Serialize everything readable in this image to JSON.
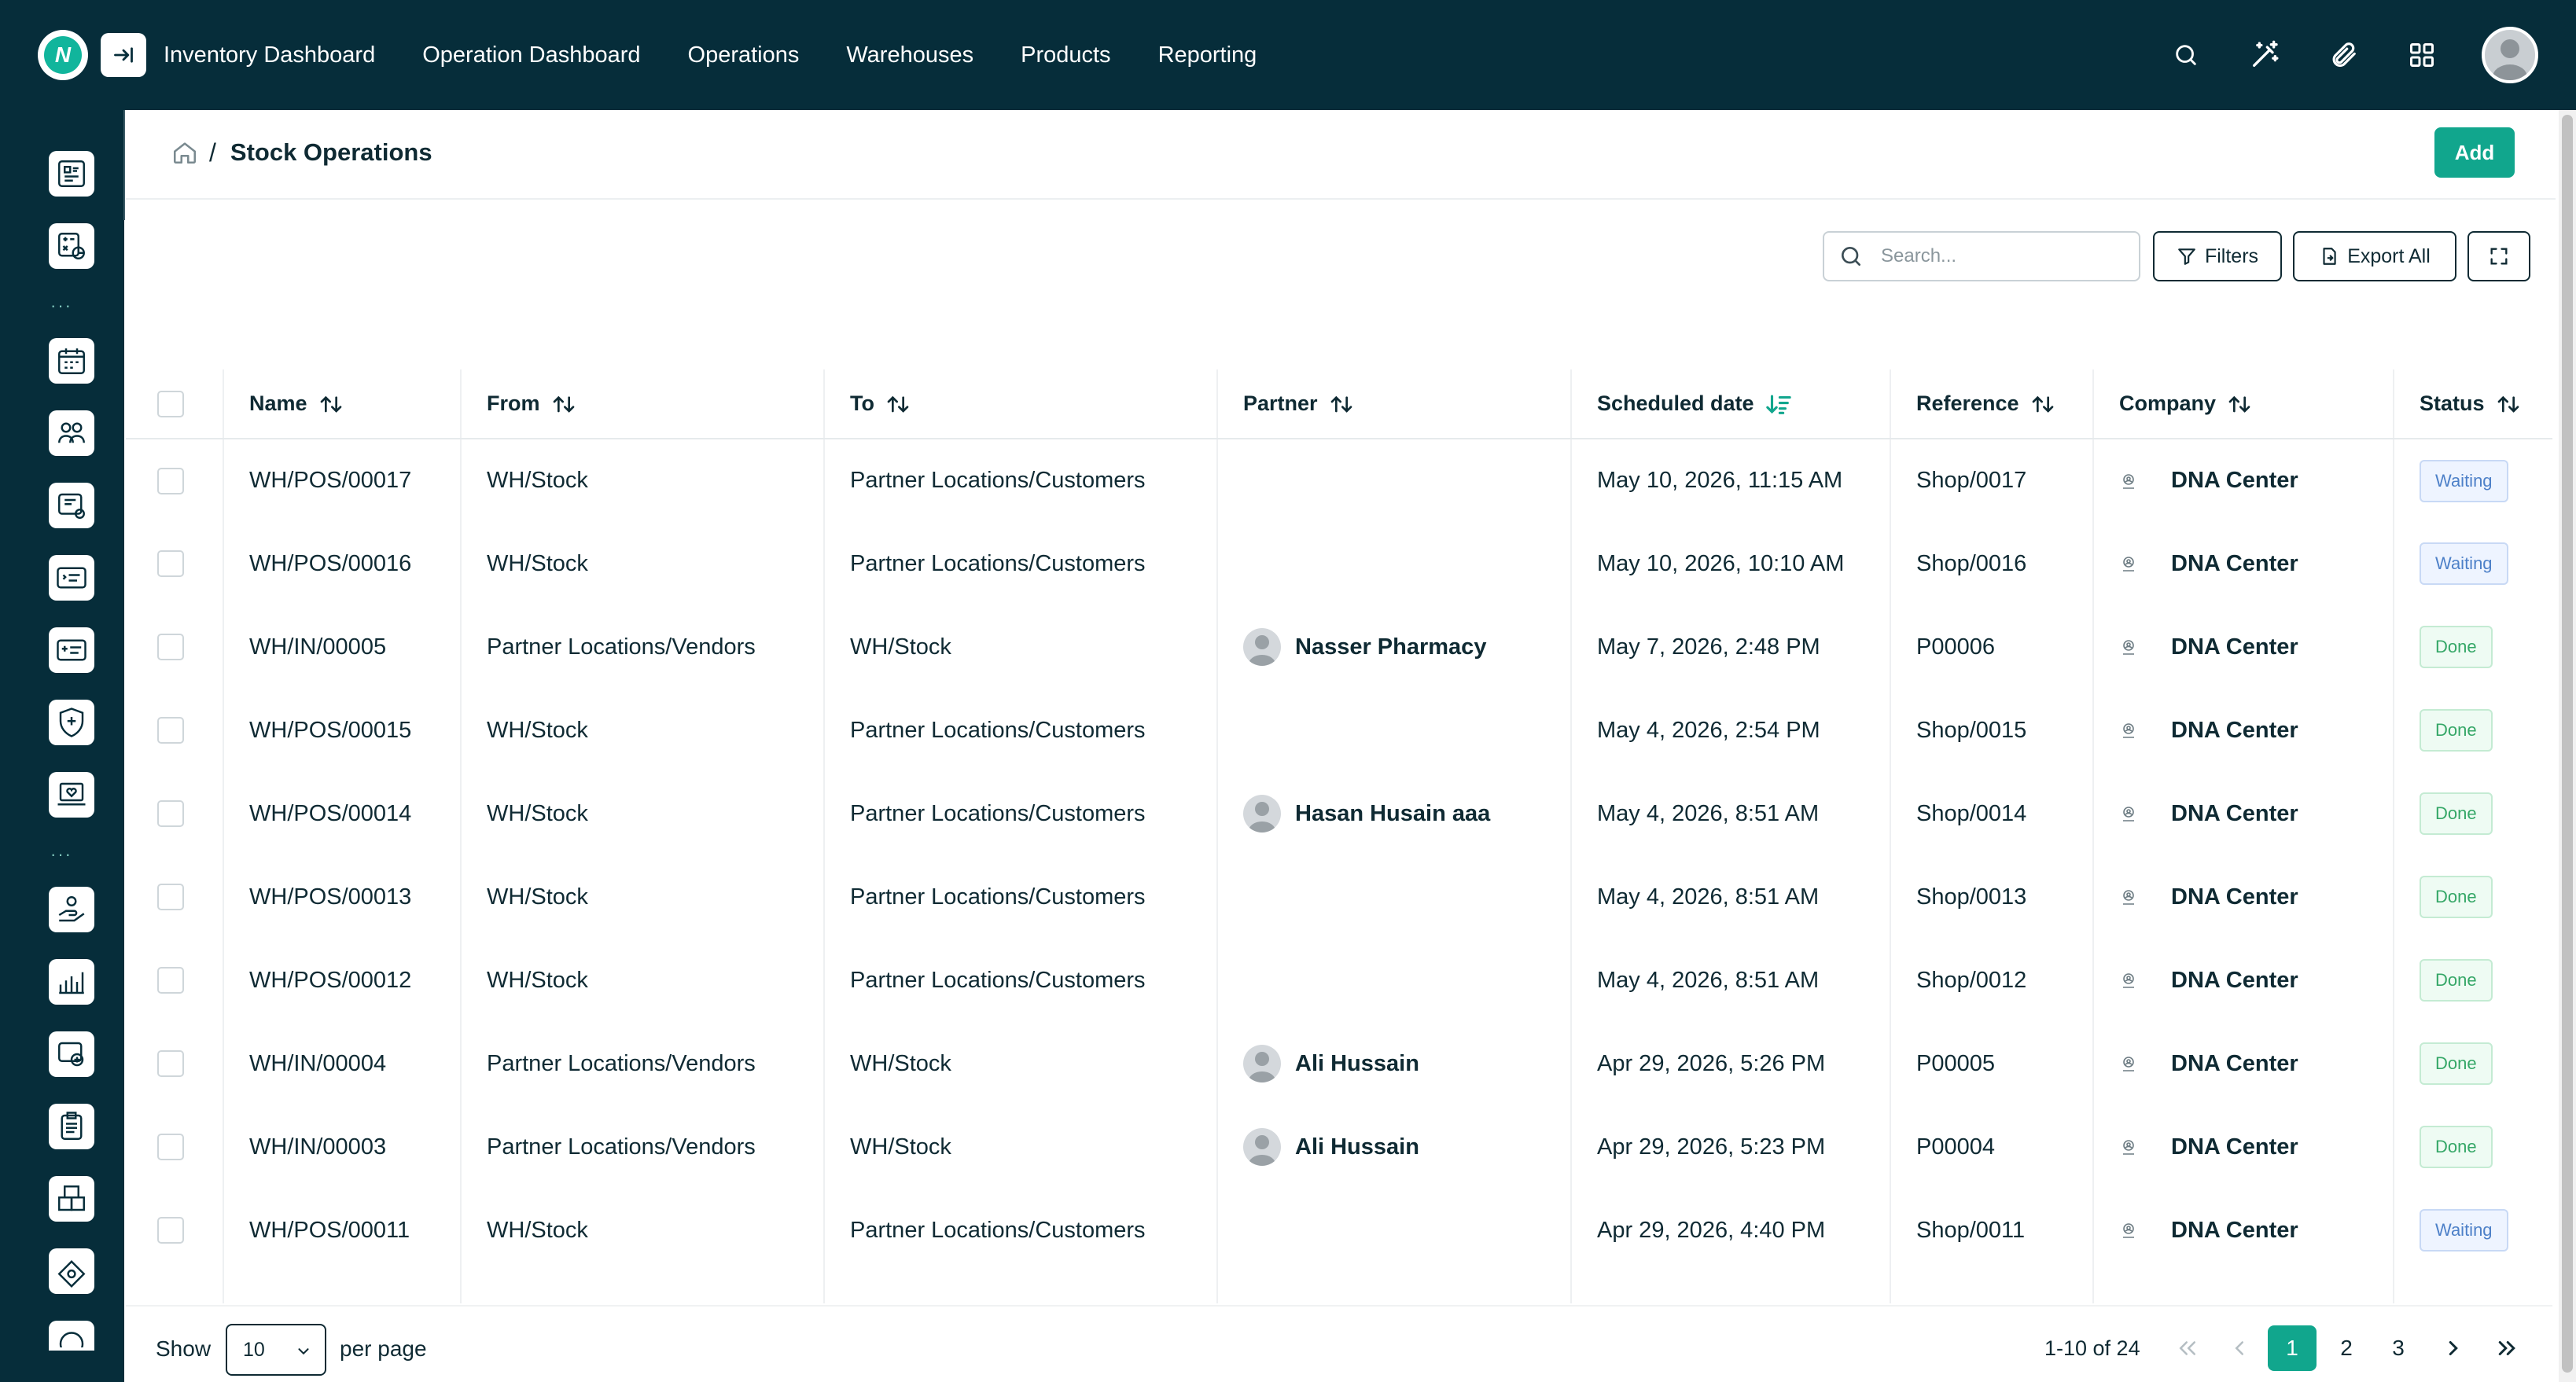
{
  "topnav": {
    "items": [
      "Inventory Dashboard",
      "Operation Dashboard",
      "Operations",
      "Warehouses",
      "Products",
      "Reporting"
    ]
  },
  "top_icons": [
    "search-icon",
    "magic-wand-icon",
    "paperclip-icon",
    "apps-grid-icon",
    "user-avatar"
  ],
  "sidebar_icons": [
    "inventory-report-icon",
    "calculator-chart-icon",
    "calendar-grid-icon",
    "team-icon",
    "ticket-settings-icon",
    "id-card-icon",
    "id-card-alt-icon",
    "shield-doctor-icon",
    "laptop-heart-icon",
    "hand-care-icon",
    "bar-chart-icon",
    "chat-medical-icon",
    "clipboard-list-icon",
    "boxes-icon",
    "cash-icon"
  ],
  "breadcrumb": {
    "home": "home-icon",
    "separator": "/",
    "title": "Stock Operations"
  },
  "add_label": "Add",
  "toolbar": {
    "search_placeholder": "Search...",
    "filters_label": "Filters",
    "export_label": "Export All"
  },
  "columns": {
    "name": "Name",
    "from": "From",
    "to": "To",
    "partner": "Partner",
    "scheduled": "Scheduled date",
    "reference": "Reference",
    "company": "Company",
    "status": "Status"
  },
  "rows": [
    {
      "name": "WH/POS/00017",
      "from": "WH/Stock",
      "to": "Partner Locations/Customers",
      "partner": "",
      "scheduled": "May 10, 2026, 11:15 AM",
      "reference": "Shop/0017",
      "company": "DNA Center",
      "status": "Waiting"
    },
    {
      "name": "WH/POS/00016",
      "from": "WH/Stock",
      "to": "Partner Locations/Customers",
      "partner": "",
      "scheduled": "May 10, 2026, 10:10 AM",
      "reference": "Shop/0016",
      "company": "DNA Center",
      "status": "Waiting"
    },
    {
      "name": "WH/IN/00005",
      "from": "Partner Locations/Vendors",
      "to": "WH/Stock",
      "partner": "Nasser Pharmacy",
      "scheduled": "May 7, 2026, 2:48 PM",
      "reference": "P00006",
      "company": "DNA Center",
      "status": "Done"
    },
    {
      "name": "WH/POS/00015",
      "from": "WH/Stock",
      "to": "Partner Locations/Customers",
      "partner": "",
      "scheduled": "May 4, 2026, 2:54 PM",
      "reference": "Shop/0015",
      "company": "DNA Center",
      "status": "Done"
    },
    {
      "name": "WH/POS/00014",
      "from": "WH/Stock",
      "to": "Partner Locations/Customers",
      "partner": "Hasan Husain aaa",
      "scheduled": "May 4, 2026, 8:51 AM",
      "reference": "Shop/0014",
      "company": "DNA Center",
      "status": "Done"
    },
    {
      "name": "WH/POS/00013",
      "from": "WH/Stock",
      "to": "Partner Locations/Customers",
      "partner": "",
      "scheduled": "May 4, 2026, 8:51 AM",
      "reference": "Shop/0013",
      "company": "DNA Center",
      "status": "Done"
    },
    {
      "name": "WH/POS/00012",
      "from": "WH/Stock",
      "to": "Partner Locations/Customers",
      "partner": "",
      "scheduled": "May 4, 2026, 8:51 AM",
      "reference": "Shop/0012",
      "company": "DNA Center",
      "status": "Done"
    },
    {
      "name": "WH/IN/00004",
      "from": "Partner Locations/Vendors",
      "to": "WH/Stock",
      "partner": "Ali Hussain",
      "scheduled": "Apr 29, 2026, 5:26 PM",
      "reference": "P00005",
      "company": "DNA Center",
      "status": "Done"
    },
    {
      "name": "WH/IN/00003",
      "from": "Partner Locations/Vendors",
      "to": "WH/Stock",
      "partner": "Ali Hussain",
      "scheduled": "Apr 29, 2026, 5:23 PM",
      "reference": "P00004",
      "company": "DNA Center",
      "status": "Done"
    },
    {
      "name": "WH/POS/00011",
      "from": "WH/Stock",
      "to": "Partner Locations/Customers",
      "partner": "",
      "scheduled": "Apr 29, 2026, 4:40 PM",
      "reference": "Shop/0011",
      "company": "DNA Center",
      "status": "Waiting"
    }
  ],
  "footer": {
    "show_label": "Show",
    "per_page_value": "10",
    "per_page_label": "per page",
    "range": "1-10 of 24",
    "pages": [
      "1",
      "2",
      "3"
    ],
    "current_page": "1"
  },
  "colors": {
    "brand_dark": "#062d3a",
    "accent": "#11a68d",
    "waiting": "#4d80c8",
    "done": "#35a767"
  }
}
